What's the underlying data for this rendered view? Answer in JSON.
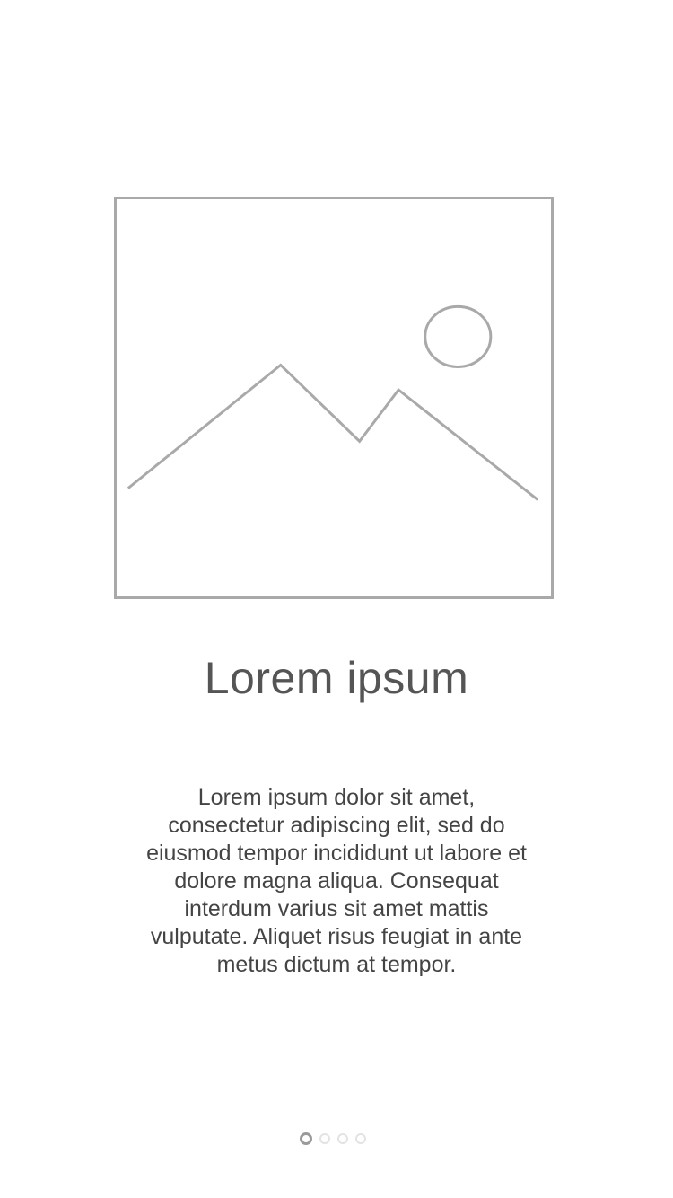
{
  "onboarding": {
    "image": {
      "icon": "image-placeholder-icon",
      "stroke_color": "#a9a9a9"
    },
    "title": "Lorem ipsum",
    "description": "Lorem ipsum dolor sit amet, consectetur adipiscing elit, sed do eiusmod tempor incididunt ut labore et dolore magna aliqua. Consequat interdum varius sit amet mattis vulputate. Aliquet risus feugiat in ante metus dictum at tempor."
  },
  "pager": {
    "total_pages": 4,
    "current_page": 1,
    "active_color": "#9a9a9a",
    "inactive_color": "#e3e3e3"
  }
}
